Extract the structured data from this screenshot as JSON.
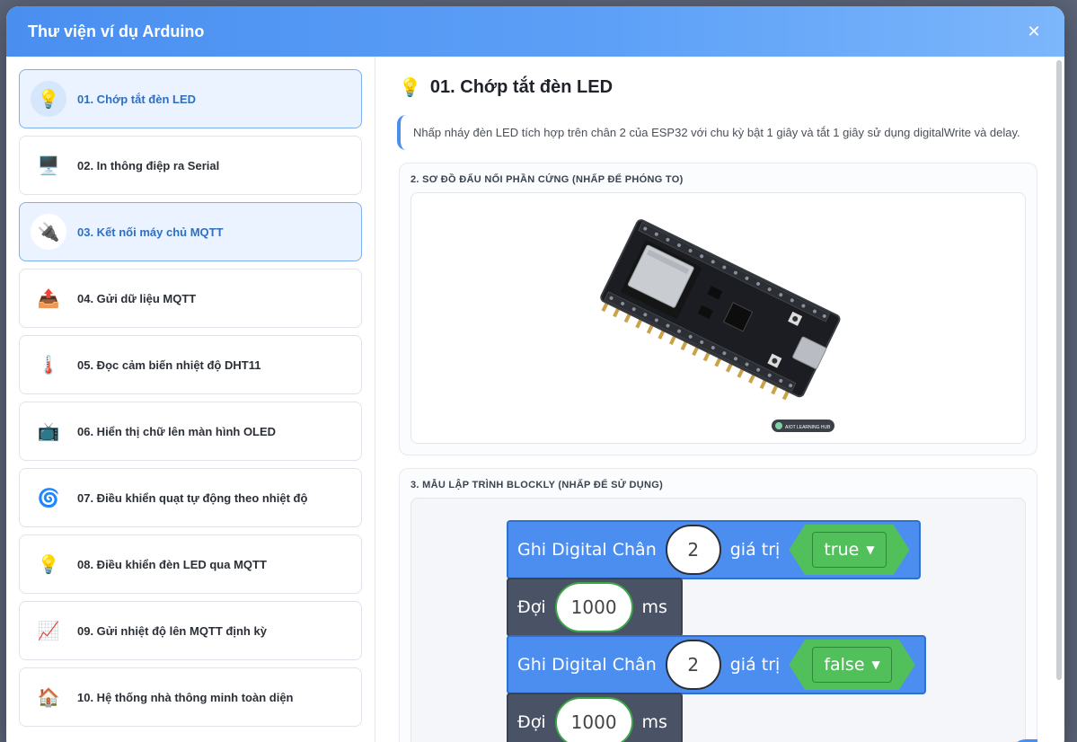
{
  "modal": {
    "title": "Thư viện ví dụ Arduino",
    "close": "✕"
  },
  "examples": [
    {
      "icon": "💡",
      "label": "01. Chớp tắt đèn LED"
    },
    {
      "icon": "🖥️",
      "label": "02. In thông điệp ra Serial"
    },
    {
      "icon": "🔌",
      "label": "03. Kết nối máy chủ MQTT"
    },
    {
      "icon": "📤",
      "label": "04. Gửi dữ liệu MQTT"
    },
    {
      "icon": "🌡️",
      "label": "05. Đọc cảm biến nhiệt độ DHT11"
    },
    {
      "icon": "📺",
      "label": "06. Hiển thị chữ lên màn hình OLED"
    },
    {
      "icon": "🌀",
      "label": "07. Điều khiển quạt tự động theo nhiệt độ"
    },
    {
      "icon": "💡",
      "label": "08. Điều khiển đèn LED qua MQTT"
    },
    {
      "icon": "📈",
      "label": "09. Gửi nhiệt độ lên MQTT định kỳ"
    },
    {
      "icon": "🏠",
      "label": "10. Hệ thống nhà thông minh toàn diện"
    }
  ],
  "detail": {
    "icon": "💡",
    "title": "01. Chớp tắt đèn LED",
    "description": "Nhấp nháy đèn LED tích hợp trên chân 2 của ESP32 với chu kỳ bật 1 giây và tắt 1 giây sử dụng digitalWrite và delay.",
    "hardware_title": "2. SƠ ĐỒ ĐẤU NỐI PHẦN CỨNG (NHẤP ĐỂ PHÓNG TO)",
    "board_badge": "AIOT LEARNING HUB",
    "blockly_title": "3. MẪU LẬP TRÌNH BLOCKLY (NHẤP ĐỂ SỬ DỤNG)"
  },
  "blocks": [
    {
      "label": "Ghi Digital Chân",
      "pin": "2",
      "value_label": "giá trị",
      "value": "true"
    },
    {
      "label": "Đợi",
      "ms_value": "1000",
      "unit": "ms"
    },
    {
      "label": "Ghi Digital Chân",
      "pin": "2",
      "value_label": "giá trị",
      "value": "false"
    },
    {
      "label": "Đợi",
      "ms_value": "1000",
      "unit": "ms"
    }
  ]
}
